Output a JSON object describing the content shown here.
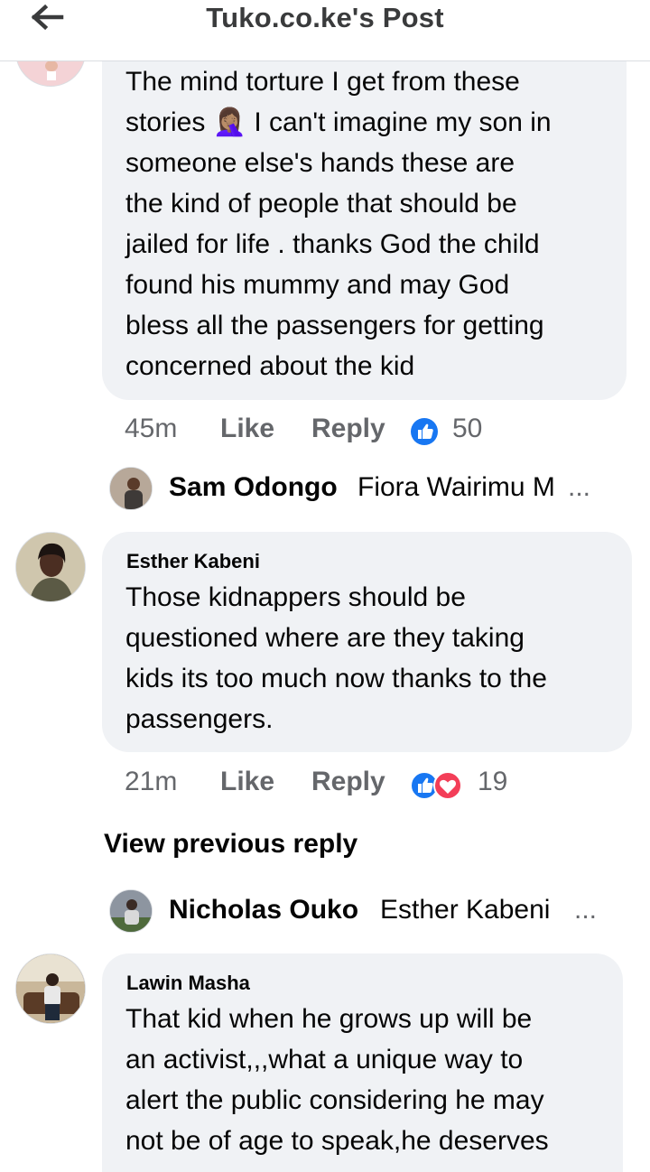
{
  "header": {
    "title": "Tuko.co.ke's Post",
    "back_icon": "arrow-left-icon"
  },
  "colors": {
    "bubble": "#f0f2f5",
    "secondary_text": "#65676b",
    "like_blue": "#1877f2",
    "love_red": "#f33e58"
  },
  "comments": [
    {
      "author": "",
      "text": "The mind torture I get from these\nstories 🤦🏽‍♀️ I can't imagine my son in\nsomeone else's hands these are\nthe kind of people that should be\njailed for life . thanks God the child\nfound his mummy and may God\nbless all the passengers for getting\nconcerned about the kid",
      "time": "45m",
      "like_label": "Like",
      "reply_label": "Reply",
      "reactions": [
        "like-icon"
      ],
      "reaction_count": "50"
    },
    {
      "author": "Esther Kabeni",
      "text": "Those kidnappers should be\nquestioned where are they taking\nkids its too much now thanks to the\npassengers.",
      "time": "21m",
      "like_label": "Like",
      "reply_label": "Reply",
      "reactions": [
        "like-icon",
        "love-icon"
      ],
      "reaction_count": "19"
    },
    {
      "author": "Lawin Masha",
      "text": "That kid when he grows up will be\nan activist,,,what a unique way to\nalert the public considering he may\nnot be of age to speak,he deserves"
    }
  ],
  "replies": [
    {
      "name": "Sam Odongo",
      "preview": "Fiora Wairimu M",
      "ellipsis": "..."
    },
    {
      "name": "Nicholas Ouko",
      "preview": "Esther Kabeni",
      "ellipsis": "..."
    }
  ],
  "view_previous_reply": "View previous reply"
}
